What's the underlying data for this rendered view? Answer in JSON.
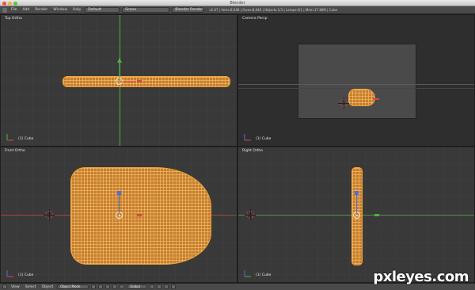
{
  "window": {
    "title": "Blender"
  },
  "menubar": {
    "items": [
      "File",
      "Add",
      "Render",
      "Window",
      "Help"
    ],
    "layout": "Default",
    "scene": "Scene",
    "engine": "Blender Render",
    "info": "v2.67 | Verts:8,048 | Faces:8,046 | Objects:1/3 | Lamps:0/1 | Mem:17.86M | Cube"
  },
  "viewports": {
    "top": {
      "label": "Top Ortho",
      "object": "(1) Cube"
    },
    "camera": {
      "label": "Camera Persp",
      "object": "(1) Cube"
    },
    "front": {
      "label": "Front Ortho",
      "object": "(1) Cube"
    },
    "right": {
      "label": "Right Ortho",
      "object": "(1) Cube"
    }
  },
  "bottombar": {
    "view": "View",
    "select": "Select",
    "object": "Object",
    "mode": "Object Mode",
    "orientation": "Global"
  },
  "watermark": "pxleyes.com",
  "colors": {
    "wire": "#f3a23a",
    "axis_x": "#d64a4a",
    "axis_y": "#4fb240",
    "axis_z": "#4a6fd6"
  }
}
